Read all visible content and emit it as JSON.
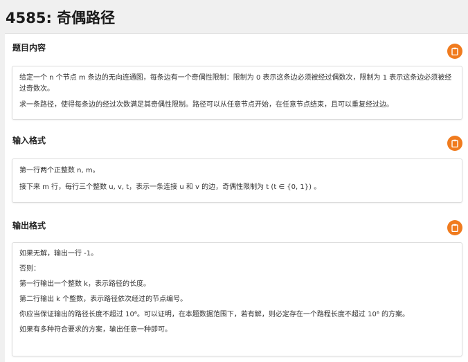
{
  "title": "4585: 奇偶路径",
  "sections": {
    "description": {
      "heading": "题目内容",
      "p1": "给定一个 n 个节点 m 条边的无向连通图，每条边有一个奇偶性限制：限制为 0 表示这条边必须被经过偶数次，限制为 1 表示这条边必须被经过奇数次。",
      "p2": "求一条路径，使得每条边的经过次数满足其奇偶性限制。路径可以从任意节点开始，在任意节点结束，且可以重复经过边。"
    },
    "input": {
      "heading": "输入格式",
      "p1": "第一行两个正整数 n, m。",
      "p2": "接下来 m 行，每行三个整数 u, v, t，表示一条连接 u 和 v 的边，奇偶性限制为 t (t ∈ {0, 1}) 。"
    },
    "output": {
      "heading": "输出格式",
      "lines": [
        "如果无解，输出一行 -1。",
        "否则：",
        "第一行输出一个整数 k，表示路径的长度。",
        "第二行输出 k 个整数，表示路径依次经过的节点编号。",
        "你应当保证输出的路径长度不超过 10⁶。可以证明，在本题数据范围下，若有解，则必定存在一个路程长度不超过 10⁶ 的方案。",
        "如果有多种符合要求的方案，输出任意一种即可。"
      ]
    }
  },
  "colors": {
    "accent": "#f07b1e",
    "background": "#f0f0f0"
  },
  "icons": {
    "copy": "clipboard-icon"
  }
}
